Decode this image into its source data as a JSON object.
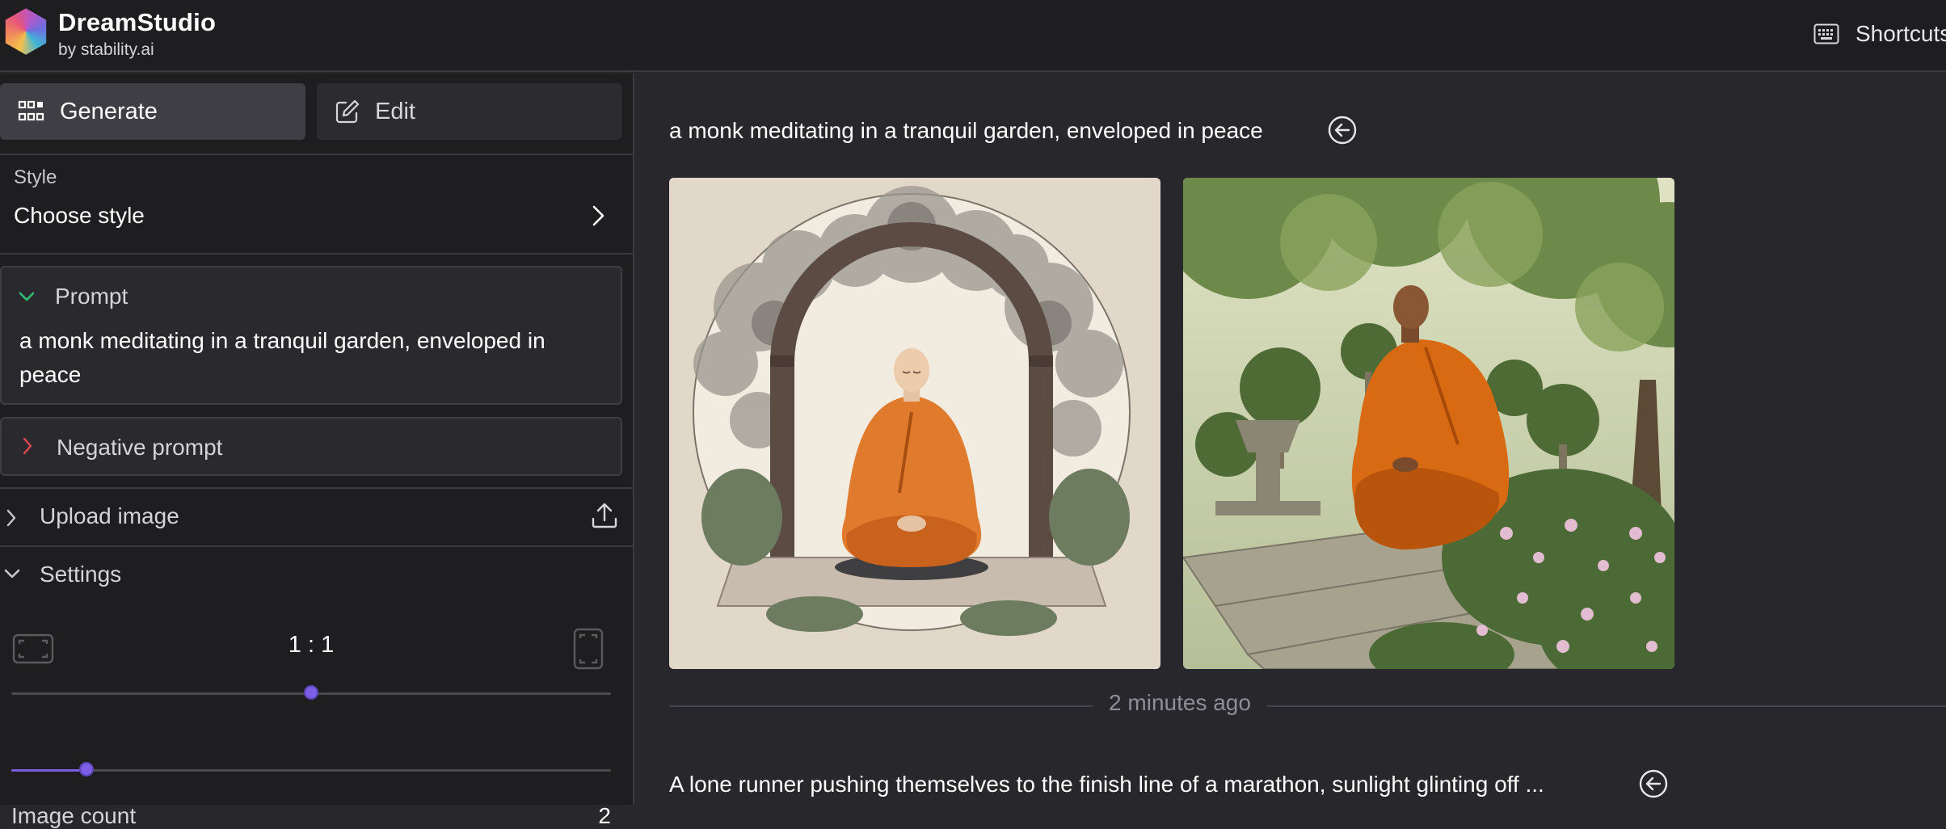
{
  "app": {
    "name": "DreamStudio",
    "byline": "by stability.ai",
    "shortcuts_label": "Shortcuts"
  },
  "sidebar": {
    "tabs": [
      {
        "label": "Generate",
        "icon": "grid-icon",
        "active": true
      },
      {
        "label": "Edit",
        "icon": "edit-icon",
        "active": false
      }
    ],
    "style": {
      "label": "Style",
      "value": "Choose style"
    },
    "prompt": {
      "title": "Prompt",
      "text": "a monk meditating in a tranquil garden, enveloped in peace",
      "expanded": true
    },
    "negative_prompt": {
      "title": "Negative prompt",
      "expanded": false
    },
    "upload_image": {
      "title": "Upload image",
      "expanded": false
    },
    "settings": {
      "title": "Settings",
      "expanded": true,
      "aspect_ratio": {
        "value": "1 : 1",
        "slider_fraction": 0.5
      },
      "image_count": {
        "label": "Image count",
        "value": "2",
        "slider_fraction": 0.125
      }
    }
  },
  "main": {
    "generations": [
      {
        "prompt": "a monk meditating in a tranquil garden, enveloped in peace",
        "images": [
          {
            "name": "generated-image-1",
            "description": "monk under stone arch illustration"
          },
          {
            "name": "generated-image-2",
            "description": "monk sitting in garden"
          }
        ],
        "timestamp": "2 minutes ago"
      },
      {
        "prompt": "A lone runner pushing themselves to the finish line of a marathon, sunlight glinting off ..."
      }
    ]
  },
  "colors": {
    "accent": "#7d5fe6",
    "prompt_chevron": "#2fbf71",
    "negative_chevron": "#e0484c",
    "panel": "#1e1e21",
    "background": "#28282c"
  }
}
